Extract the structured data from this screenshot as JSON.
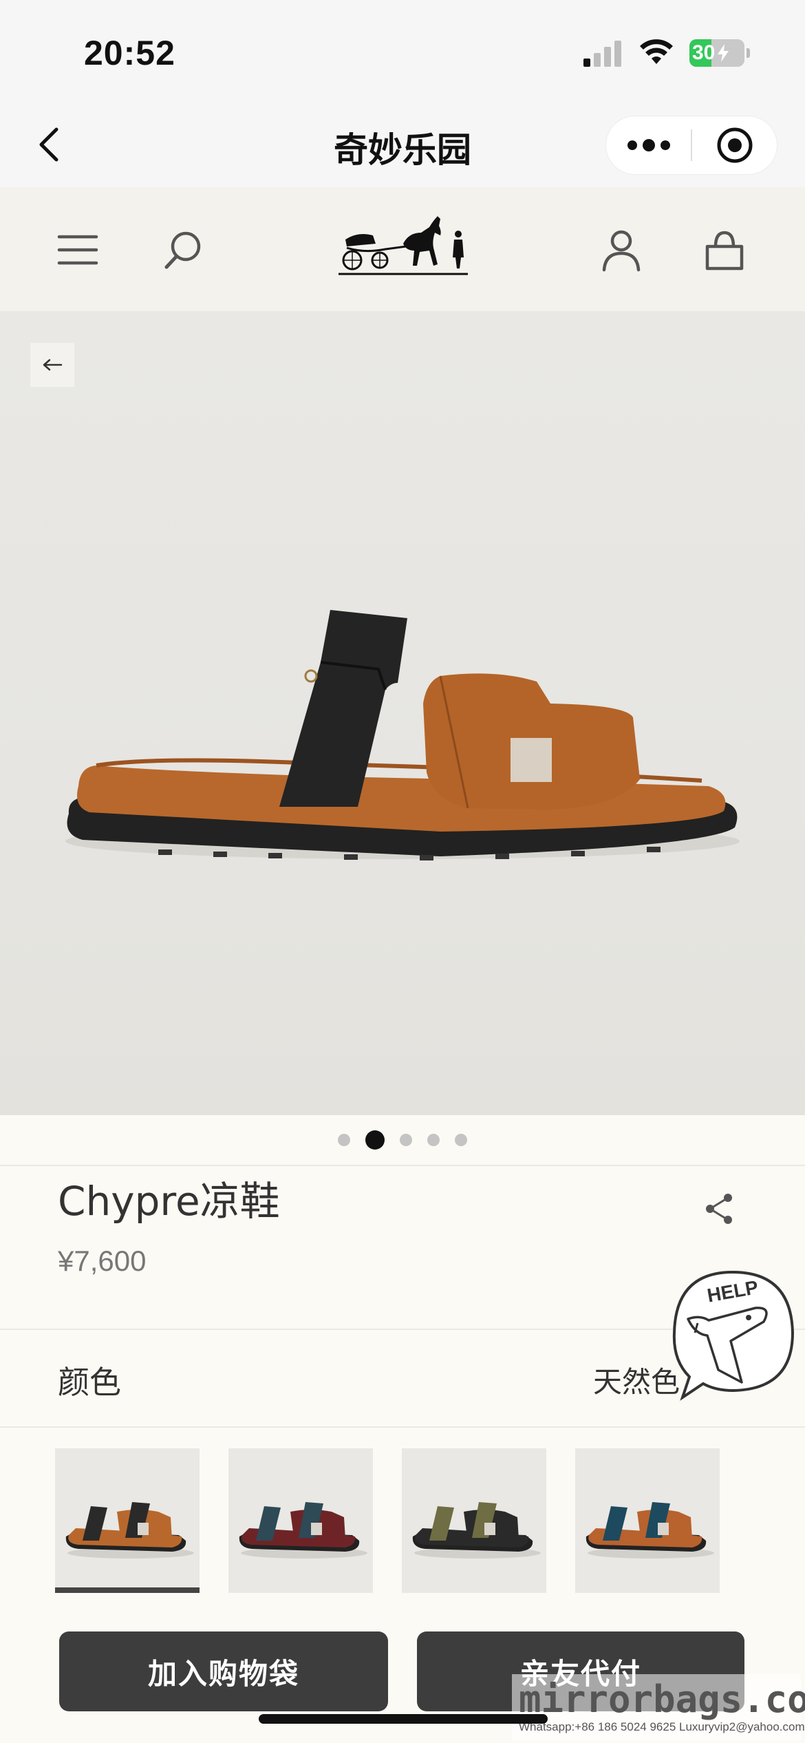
{
  "status_bar": {
    "time": "20:52",
    "battery": "30",
    "icons": [
      "cellular-signal-icon",
      "wifi-icon",
      "battery-charging-icon"
    ]
  },
  "mini_program_nav": {
    "title": "奇妙乐园",
    "icons": [
      "back-chevron-icon",
      "more-dots-icon",
      "close-target-icon"
    ]
  },
  "site_header": {
    "icons": [
      "menu-icon",
      "search-icon",
      "carriage-logo",
      "account-icon",
      "shopping-bag-icon"
    ]
  },
  "gallery": {
    "page_count": 5,
    "active_index": 1,
    "back_icon": "arrow-left-icon"
  },
  "product": {
    "name": "Chypre凉鞋",
    "price": "¥7,600"
  },
  "color": {
    "label": "颜色",
    "value": "天然色"
  },
  "swatches": [
    {
      "name": "tan-black",
      "strap": "#2a2a2a",
      "body": "#b8682c",
      "selected": true
    },
    {
      "name": "bordeaux-teal",
      "strap": "#2d4a56",
      "body": "#6e2426",
      "selected": false
    },
    {
      "name": "khaki-black",
      "strap": "#6f6d43",
      "body": "#2a2a2a",
      "selected": false
    },
    {
      "name": "teal-tan",
      "strap": "#1d4a5e",
      "body": "#b8622e",
      "selected": false
    }
  ],
  "actions": {
    "add_to_bag": "加入购物袋",
    "friend_pay": "亲友代付"
  },
  "help": {
    "label": "HELP"
  },
  "watermark": {
    "main": "mirrorbags.com",
    "sub": "Whatsapp:+86 186 5024 9625   Luxuryvip2@yahoo.com"
  }
}
